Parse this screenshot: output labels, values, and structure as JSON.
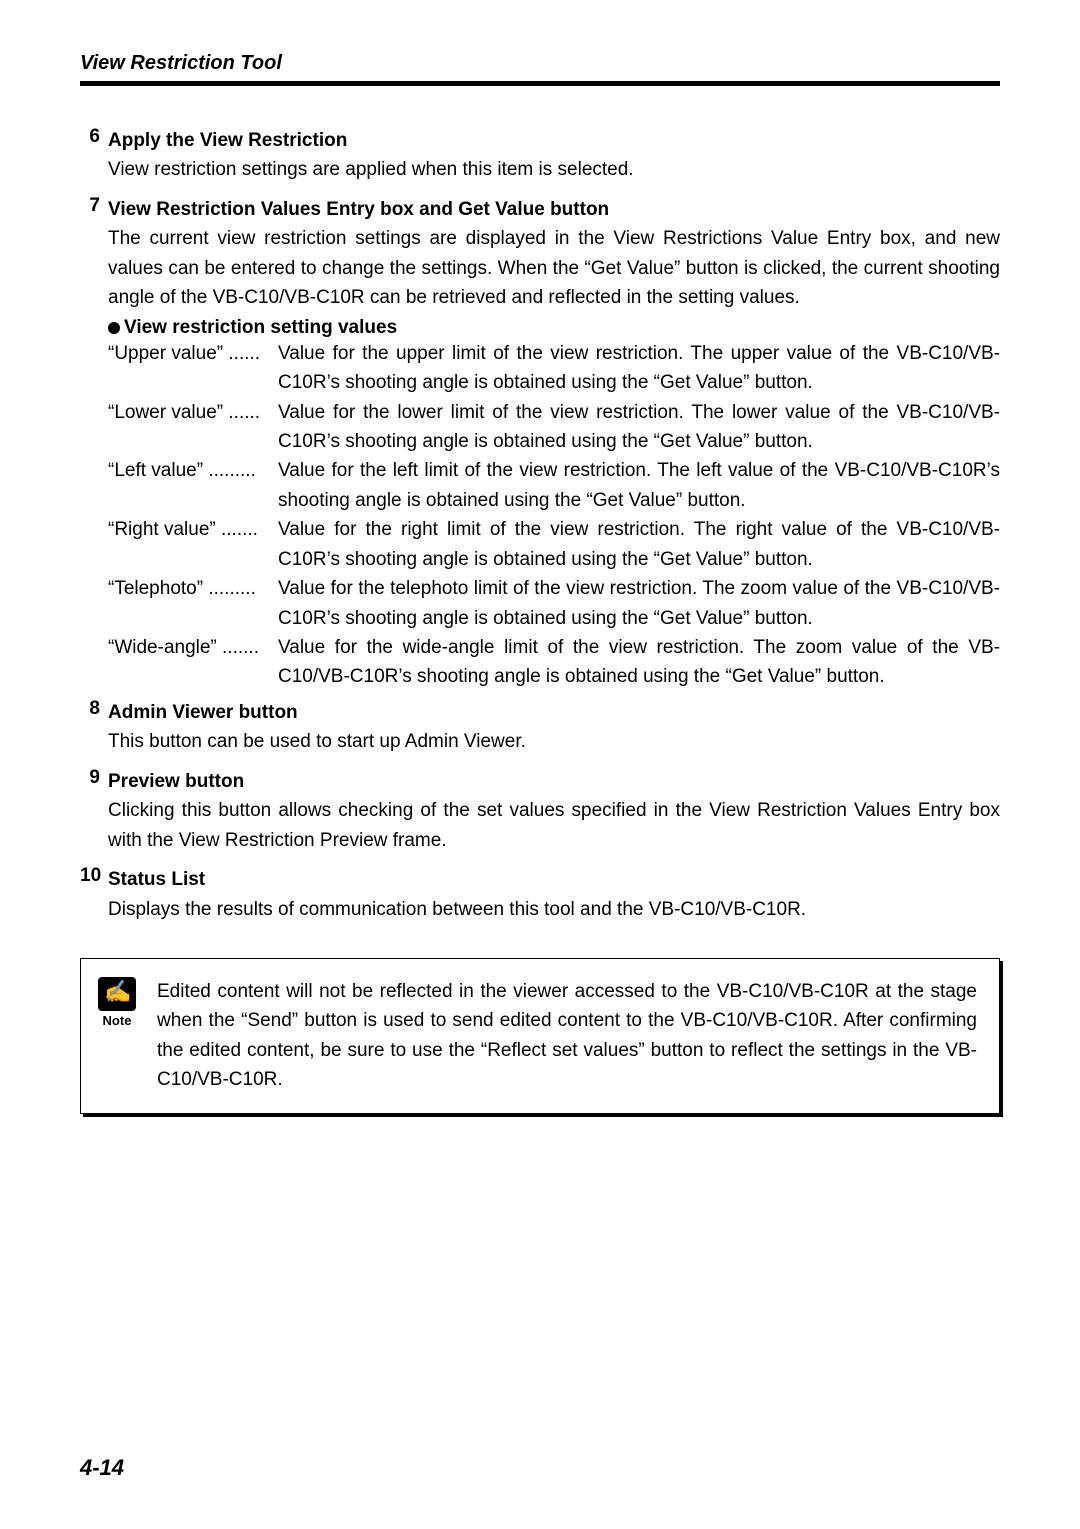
{
  "header": {
    "title": "View Restriction Tool"
  },
  "items": [
    {
      "num": "6",
      "title": "Apply the View Restriction",
      "text": "View restriction settings are applied when this item is selected.",
      "bullet_heading": null,
      "defs": null
    },
    {
      "num": "7",
      "title": "View Restriction Values Entry box and Get Value button",
      "text": "The current view restriction settings are displayed in the View Restrictions Value Entry box, and new values can be entered to change the settings. When the “Get Value” button is clicked, the current shooting angle of the VB-C10/VB-C10R can be retrieved and reflected in the setting values.",
      "bullet_heading": "View restriction setting values",
      "defs": [
        {
          "term": "“Upper value” ......",
          "desc": "Value for the upper limit of the view restriction. The upper value of the VB-C10/VB-C10R’s shooting angle is obtained using the “Get Value” button."
        },
        {
          "term": "“Lower value” ......",
          "desc": "Value for the lower limit of the view restriction. The lower value of the VB-C10/VB-C10R’s shooting angle is obtained using the “Get Value” button."
        },
        {
          "term": "“Left value” .........",
          "desc": "Value for the left limit of the view restriction. The left value of the VB-C10/VB-C10R’s shooting angle is obtained using the “Get Value” button."
        },
        {
          "term": "“Right value” .......",
          "desc": "Value for the right limit of the view restriction. The right value of the VB-C10/VB-C10R’s shooting angle is obtained using the “Get Value” button."
        },
        {
          "term": "“Telephoto” .........",
          "desc": "Value for the telephoto limit of the view restriction. The zoom value of the VB-C10/VB-C10R’s shooting angle is obtained using the “Get Value” button."
        },
        {
          "term": "“Wide-angle” .......",
          "desc": "Value for the wide-angle limit of the view restriction. The zoom value of the VB-C10/VB-C10R’s shooting angle is obtained using the “Get Value” button."
        }
      ]
    },
    {
      "num": "8",
      "title": "Admin Viewer button",
      "text": "This button can be used to start up Admin Viewer.",
      "bullet_heading": null,
      "defs": null
    },
    {
      "num": "9",
      "title": "Preview button",
      "text": "Clicking this button allows checking of the set values specified in the View Restriction Values Entry box with the View Restriction Preview frame.",
      "bullet_heading": null,
      "defs": null
    },
    {
      "num": "10",
      "title": "Status List",
      "text": "Displays the results of communication between this tool and the VB-C10/VB-C10R.",
      "bullet_heading": null,
      "defs": null
    }
  ],
  "note": {
    "label": "Note",
    "text": "Edited content will not be reflected in the viewer accessed to the VB-C10/VB-C10R at the stage when the “Send” button is used to send edited content to the VB-C10/VB-C10R. After confirming the edited content, be sure to use the “Reflect set values” button to reflect the settings in the VB-C10/VB-C10R."
  },
  "footer": {
    "page": "4-14"
  }
}
